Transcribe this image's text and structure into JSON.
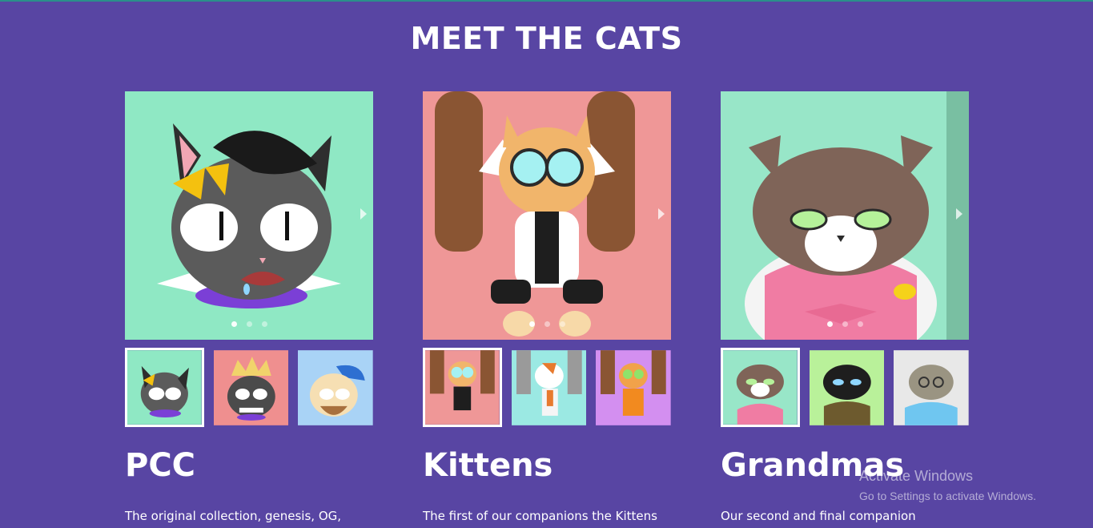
{
  "page": {
    "title": "MEET THE CATS"
  },
  "collections": [
    {
      "name": "PCC",
      "description": "The original collection, genesis, OG,",
      "slide_bg": "#8fe8c4",
      "thumbs": [
        {
          "bg": "#8fe8c4",
          "label": "PCC cat with yellow bow"
        },
        {
          "bg": "#ef8f8f",
          "label": "PCC cat with crown"
        },
        {
          "bg": "#a9d3f6",
          "label": "PCC cat with blue cap"
        }
      ],
      "active_slide": 1,
      "slide_count": 3
    },
    {
      "name": "Kittens",
      "description": "The first of our companions the Kittens",
      "slide_bg": "#ef9797",
      "thumbs": [
        {
          "bg": "#ef9797",
          "label": "Kitten with goggles"
        },
        {
          "bg": "#9be9e3",
          "label": "Calico kitten"
        },
        {
          "bg": "#d38ff0",
          "label": "Orange kitten in suit"
        }
      ],
      "active_slide": 1,
      "slide_count": 3
    },
    {
      "name": "Grandmas",
      "description": "Our second and final companion",
      "slide_bg": "#98e6c8",
      "thumbs": [
        {
          "bg": "#98e6c8",
          "label": "Grandma cat in robe"
        },
        {
          "bg": "#b9f19a",
          "label": "Black grandma cat"
        },
        {
          "bg": "#e8e8e8",
          "label": "Grey grandma cat in coat"
        }
      ],
      "active_slide": 1,
      "slide_count": 3
    }
  ],
  "watermark": {
    "title": "Activate Windows",
    "subtitle": "Go to Settings to activate Windows."
  }
}
